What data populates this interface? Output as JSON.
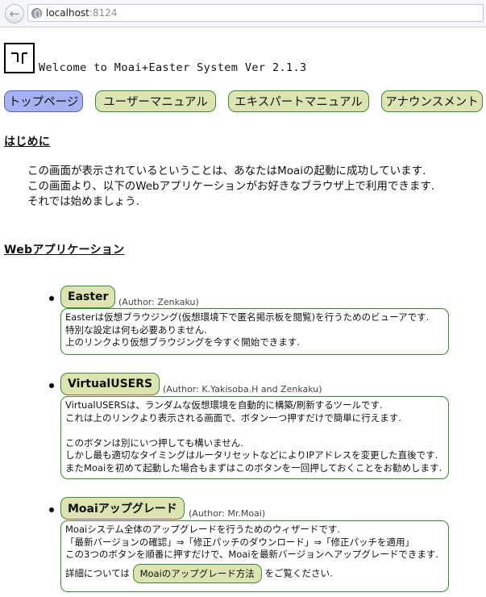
{
  "browser": {
    "url_host": "localhost",
    "url_port": ":8124"
  },
  "header": {
    "title": "Welcome to Moai+Easter System Ver 2.1.3"
  },
  "nav": {
    "items": [
      {
        "label": "トップページ",
        "active": true
      },
      {
        "label": "ユーザーマニュアル",
        "active": false
      },
      {
        "label": "エキスパートマニュアル",
        "active": false
      },
      {
        "label": "アナウンスメント",
        "active": false
      }
    ]
  },
  "intro": {
    "heading": "はじめに",
    "lines": [
      "この画面が表示されているということは、あなたはMoaiの起動に成功しています.",
      "この画面より、以下のWebアプリケーションがお好きなブラウザ上で利用できます.",
      "それでは始めましょう."
    ]
  },
  "apps": {
    "heading": "Webアプリケーション",
    "items": [
      {
        "name": "Easter",
        "author": "(Author: Zenkaku)",
        "lines": [
          "Easterは仮想ブラウジング(仮想環境下で匿名掲示板を閲覧)を行うためのビューアです.",
          "特別な設定は何も必要ありません.",
          "上のリンクより仮想ブラウジングを今すぐ開始できます."
        ]
      },
      {
        "name": "VirtualUSERS",
        "author": "(Author: K.Yakisoba.H and Zenkaku)",
        "lines": [
          "VirtualUSERSは、ランダムな仮想環境を自動的に構築/刷新するツールです.",
          "これは上のリンクより表示される画面で、ボタン一つ押すだけで簡単に行えます.",
          "",
          "このボタンは別にいつ押しても構いません.",
          "しかし最も適切なタイミングはルータリセットなどによりIPアドレスを変更した直後です.",
          "またMoaiを初めて起動した場合もまずはこのボタンを一回押しておくことをお勧めします."
        ]
      },
      {
        "name": "Moaiアップグレード",
        "author": "(Author: Mr.Moai)",
        "lines": [
          "Moaiシステム全体のアップグレードを行うためのウィザードです.",
          "「最新バージョンの確認」⇒「修正パッチのダウンロード」⇒「修正パッチを適用」",
          "この3つのボタンを順番に押すだけで、Moaiを最新バージョンへアップグレードできます."
        ],
        "detail_prefix": "詳細については",
        "detail_link": "Moaiのアップグレード方法",
        "detail_suffix": "をご覧ください."
      }
    ]
  }
}
